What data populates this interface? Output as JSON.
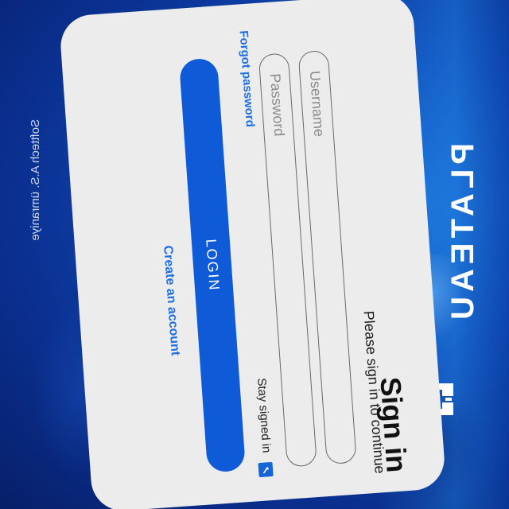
{
  "brand": {
    "name": "PLATEAU",
    "logo_icon": "plateau-logo-icon",
    "color": "#ffffff"
  },
  "login_card": {
    "heading": "Sign in",
    "subtitle": "Please sign in to continue",
    "username_placeholder": "Username",
    "password_placeholder": "Password",
    "forgot_password": "Forgot password",
    "stay_signed_in": "Stay signed in",
    "stay_signed_in_checked": true,
    "login_button": "LOGIN",
    "create_account": "Create an account"
  },
  "footer": {
    "text": "Softtech A.S. ümraniye"
  },
  "colors": {
    "accent": "#0f5ad6",
    "link": "#1f6fe0",
    "card_bg": "#ececec",
    "page_bg": "#0a2f8e"
  }
}
